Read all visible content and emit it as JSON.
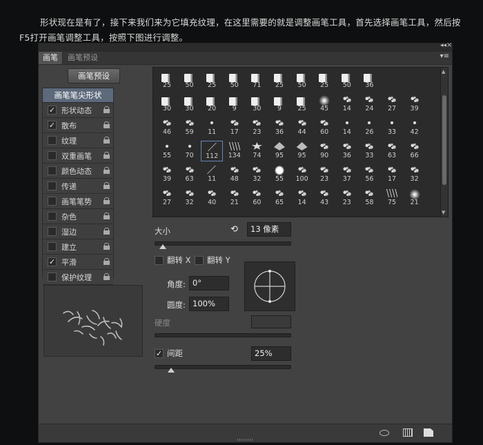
{
  "intro_text": "形状现在是有了，接下来我们来为它填充纹理，在这里需要的就是调整画笔工具，首先选择画笔工具，然后按F5打开画笔调整工具，按照下图进行调整。",
  "panel": {
    "tabs": [
      {
        "label": "画笔",
        "active": true
      },
      {
        "label": "画笔预设",
        "active": false
      }
    ],
    "collapse_glyph": "◂◂",
    "close_glyph": "×",
    "menu_glyph": "▾≡",
    "preset_button": "画笔预设",
    "props_header": "画笔笔尖形状",
    "properties": [
      {
        "label": "形状动态",
        "checked": true
      },
      {
        "label": "散布",
        "checked": true
      },
      {
        "label": "纹理",
        "checked": false
      },
      {
        "label": "双重画笔",
        "checked": false
      },
      {
        "label": "颜色动态",
        "checked": false
      },
      {
        "label": "传递",
        "checked": false
      },
      {
        "label": "画笔笔势",
        "checked": false
      },
      {
        "label": "杂色",
        "checked": false
      },
      {
        "label": "湿边",
        "checked": false
      },
      {
        "label": "建立",
        "checked": false
      },
      {
        "label": "平滑",
        "checked": true
      },
      {
        "label": "保护纹理",
        "checked": false
      }
    ]
  },
  "brushes": {
    "rows": [
      [
        "25",
        "50",
        "25",
        "50",
        "71",
        "25",
        "50",
        "25",
        "50",
        "36"
      ],
      [
        "30",
        "30",
        "20",
        "9",
        "30",
        "9",
        "25",
        "45",
        "14",
        "24",
        "27",
        "39"
      ],
      [
        "46",
        "59",
        "11",
        "17",
        "23",
        "36",
        "44",
        "60",
        "14",
        "26",
        "33",
        "42"
      ],
      [
        "55",
        "70",
        "112",
        "134",
        "74",
        "95",
        "95",
        "90",
        "36",
        "33",
        "63",
        "66"
      ],
      [
        "39",
        "63",
        "11",
        "48",
        "32",
        "55",
        "100",
        "23",
        "37",
        "56",
        "17",
        "32"
      ],
      [
        "27",
        "32",
        "40",
        "21",
        "60",
        "65",
        "14",
        "43",
        "23",
        "58",
        "75",
        "21"
      ]
    ],
    "selected_row": 3,
    "selected_col": 2
  },
  "controls": {
    "size_label": "大小",
    "size_value": "13 像素",
    "size_slider_fraction": 0.06,
    "flip_x_label": "翻转 X",
    "flip_y_label": "翻转 Y",
    "angle_label": "角度:",
    "angle_value": "0°",
    "roundness_label": "圆度:",
    "roundness_value": "100%",
    "hardness_label": "硬度",
    "spacing_label": "间距",
    "spacing_checked": true,
    "spacing_value": "25%",
    "spacing_slider_fraction": 0.12
  },
  "glyphs": {
    "check": "✓",
    "reset": "⟲",
    "scroll_up": "▲",
    "scroll_down": "▼"
  },
  "icons": [
    "lock-icon",
    "reset-icon",
    "eye-icon",
    "grid-icon",
    "new-page-icon"
  ]
}
